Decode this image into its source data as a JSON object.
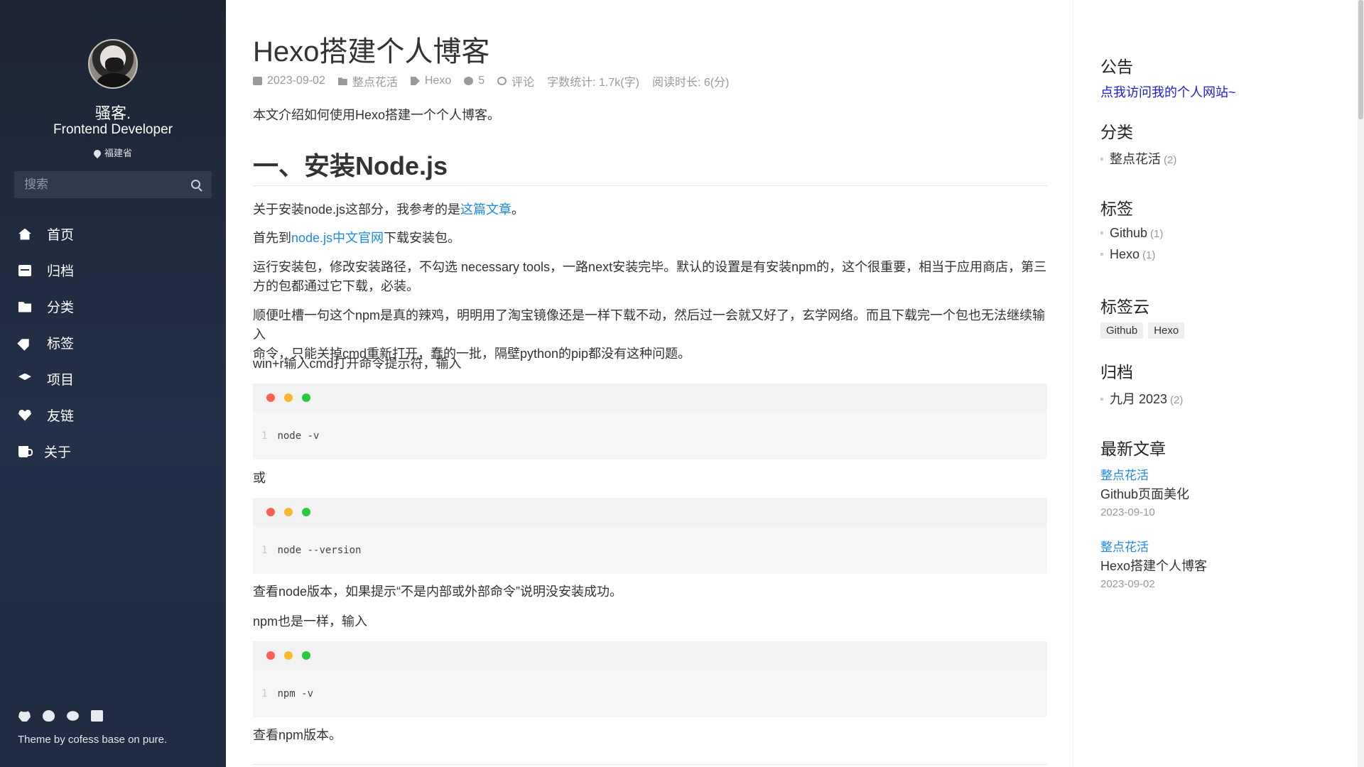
{
  "sidebar": {
    "name": "骚客.",
    "role": "Frontend Developer",
    "location": "福建省",
    "search_placeholder": "搜索",
    "nav": [
      {
        "icon": "home-icon",
        "label": "首页"
      },
      {
        "icon": "archive-icon",
        "label": "归档"
      },
      {
        "icon": "folder-icon",
        "label": "分类"
      },
      {
        "icon": "tag-icon",
        "label": "标签"
      },
      {
        "icon": "layers-icon",
        "label": "项目"
      },
      {
        "icon": "heart-icon",
        "label": "友链"
      },
      {
        "icon": "coffee-icon",
        "label": "关于"
      }
    ],
    "social": [
      "github-icon",
      "qq-icon",
      "wechat-icon",
      "mail-icon"
    ],
    "theme_note": "Theme by cofess base on pure."
  },
  "post": {
    "title": "Hexo搭建个人博客",
    "meta": {
      "date": "2023-09-02",
      "category": "整点花活",
      "tag": "Hexo",
      "views": "5",
      "comments": "评论",
      "word_count": "字数统计: 1.7k(字)",
      "read_time": "阅读时长: 6(分)"
    },
    "intro": "本文介绍如何使用Hexo搭建一个个人博客。",
    "h1": "一、安装Node.js",
    "p1_before": "关于安装node.js这部分，我参考的是",
    "p1_link": "这篇文章",
    "p1_after": "。",
    "p2_before": "首先到",
    "p2_link": "node.js中文官网",
    "p2_after": "下载安装包。",
    "p3_l1": "运行安装包，修改安装路径，不勾选 necessary tools，一路next安装完毕。默认的设置是有安装npm的，这个很重要，相当于应用商店，第三",
    "p3_l2": "方的包都通过它下载，必装。",
    "p4_l1": "顺便吐槽一句这个npm是真的辣鸡，明明用了淘宝镜像还是一样下载不动，然后过一会就又好了，玄学网络。而且下载完一个包也无法继续输入",
    "p4_l2": "命令，只能关掉cmd重新打开，蠢的一批，隔壁python的pip都没有这种问题。",
    "p5": "win+r输入cmd打开命令提示符，输入",
    "code1": {
      "ln": "1",
      "text": "node -v"
    },
    "or": "或",
    "code2": {
      "ln": "1",
      "text": "node --version"
    },
    "p6": "查看node版本，如果提示“不是内部或外部命令”说明没安装成功。",
    "p7": "npm也是一样，输入",
    "code3": {
      "ln": "1",
      "text": "npm -v"
    },
    "p8": "查看npm版本。"
  },
  "right": {
    "notice_title": "公告",
    "notice_link": "点我访问我的个人网站~",
    "cat_title": "分类",
    "cat_items": [
      {
        "label": "整点花活",
        "count": "(2)"
      }
    ],
    "tag_title": "标签",
    "tag_items": [
      {
        "label": "Github",
        "count": "(1)"
      },
      {
        "label": "Hexo",
        "count": "(1)"
      }
    ],
    "cloud_title": "标签云",
    "cloud": [
      "Github",
      "Hexo"
    ],
    "archive_title": "归档",
    "archive_items": [
      {
        "label": "九月 2023",
        "count": "(2)"
      }
    ],
    "recent_title": "最新文章",
    "recent": [
      {
        "cat": "整点花活",
        "title": "Github页面美化",
        "date": "2023-09-10"
      },
      {
        "cat": "整点花活",
        "title": "Hexo搭建个人博客",
        "date": "2023-09-02"
      }
    ]
  }
}
